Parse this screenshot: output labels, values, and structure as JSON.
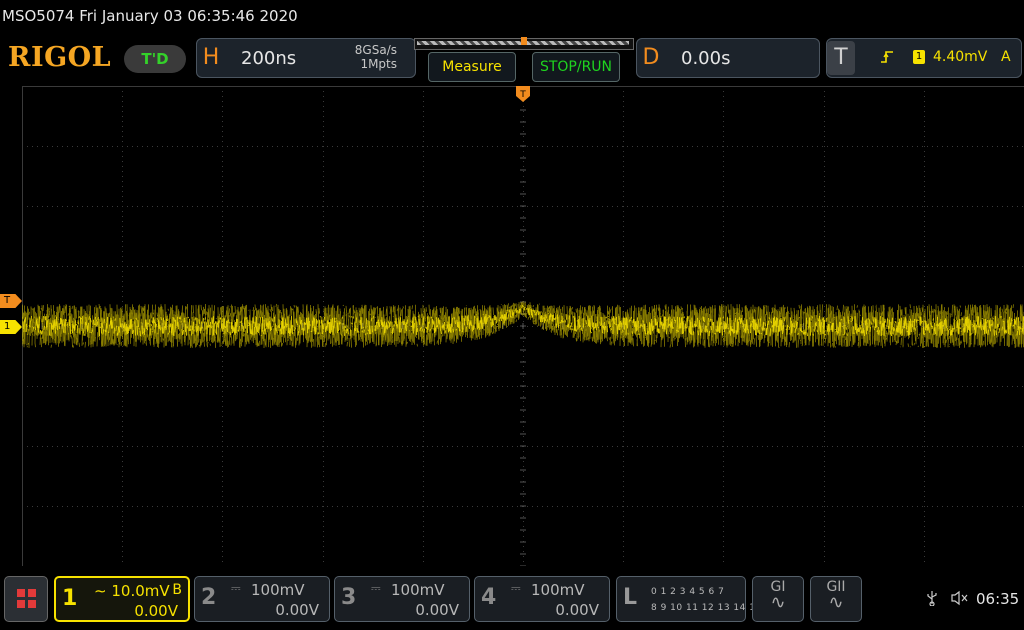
{
  "header": {
    "title": "MSO5074  Fri January 03 06:35:46 2020",
    "brand": "RIGOL",
    "run_state": "T'D"
  },
  "horizontal": {
    "letter": "H",
    "timebase": "200ns",
    "sample_rate": "8GSa/s",
    "memory_depth": "1Mpts"
  },
  "buttons": {
    "measure": "Measure",
    "stop_run": "STOP/RUN"
  },
  "delay": {
    "letter": "D",
    "value": "0.00s"
  },
  "trigger": {
    "letter": "T",
    "edge_icon": "rising-edge-icon",
    "channel": "1",
    "level": "4.40mV",
    "mode": "A"
  },
  "markers": {
    "trigger_top": "T",
    "trigger_level": "T",
    "channel1": "1"
  },
  "channels": [
    {
      "num": "1",
      "coupling_icon": "ac-coupling-icon",
      "scale": "10.0mV",
      "bw": "B",
      "offset": "0.00V"
    },
    {
      "num": "2",
      "coupling_icon": "dc-coupling-icon",
      "scale": "100mV",
      "offset": "0.00V"
    },
    {
      "num": "3",
      "coupling_icon": "dc-coupling-icon",
      "scale": "100mV",
      "offset": "0.00V"
    },
    {
      "num": "4",
      "coupling_icon": "dc-coupling-icon",
      "scale": "100mV",
      "offset": "0.00V"
    }
  ],
  "logic": {
    "letter": "L",
    "row1": "0 1 2 3  4 5 6 7",
    "row2": "8 9 10 11 12 13 14 15"
  },
  "generators": [
    {
      "label": "GI"
    },
    {
      "label": "GII"
    }
  ],
  "status": {
    "time": "06:35"
  },
  "colors": {
    "ch1": "#f7e200",
    "orange": "#f28c1e",
    "green": "#1fd41f",
    "grid": "#3a3a3a"
  }
}
